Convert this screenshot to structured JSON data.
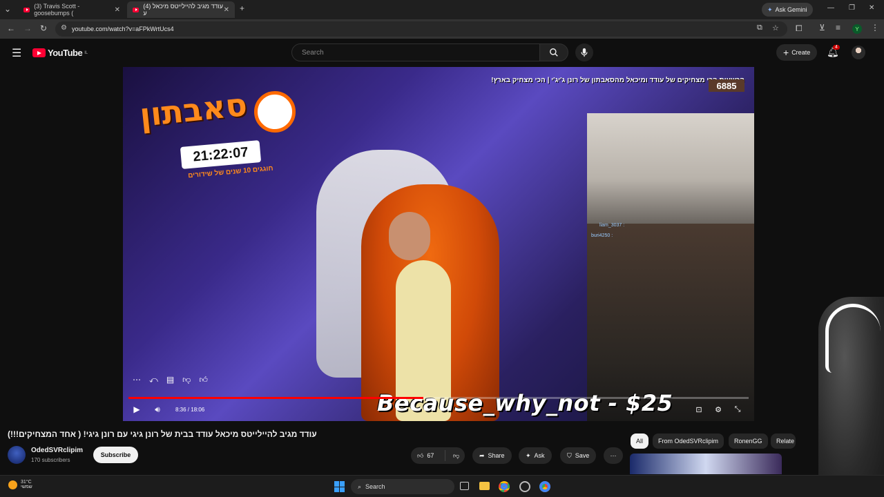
{
  "browser": {
    "tabs": [
      {
        "title": "(3) Travis Scott - goosebumps (",
        "active": false
      },
      {
        "title": "(4) עודד מגיב להיילייטס מיכאל ע",
        "active": true
      }
    ],
    "new_tab": "+",
    "url": "youtube.com/watch?v=aFPkWrtUcs4",
    "gemini_label": "Ask Gemini",
    "profile_initial": "Y"
  },
  "youtube": {
    "logo_text": "YouTube",
    "logo_region": "IL",
    "search_placeholder": "Search",
    "create_label": "Create",
    "notification_count": "4"
  },
  "video": {
    "overlay_logo": "סאבתון",
    "overlay_timer": "21:22:07",
    "overlay_subtitle": "חוגגים 10 שנים של שידורים",
    "overlay_title": "הכשעות הכי מצחיקים של עודד ומיכאל מהסאבתון של רונן ג'יג'י | הכי מצחיק בארץ!",
    "viewers": "6885",
    "chat": [
      "liam_3037 :",
      "buri4250 :"
    ],
    "donation": "Because_why_not - $25",
    "time": "8:36 / 18:06",
    "progress": 0.475
  },
  "info": {
    "title": "עודד מגיב להיילייטס מיכאל עודד בבית של רונן גיגי עם רונן גיגי! ( אחד המצחיקים!!!)",
    "channel": "OdedSVRclipim",
    "subscribers": "170 subscribers",
    "subscribe_label": "Subscribe",
    "likes": "67",
    "share_label": "Share",
    "ask_label": "Ask",
    "save_label": "Save"
  },
  "chips": [
    "All",
    "From OdedSVRclipim",
    "RonenGG",
    "Relate"
  ],
  "taskbar": {
    "temp": "31°C",
    "weather_text": "שמשי",
    "search_label": "Search"
  }
}
